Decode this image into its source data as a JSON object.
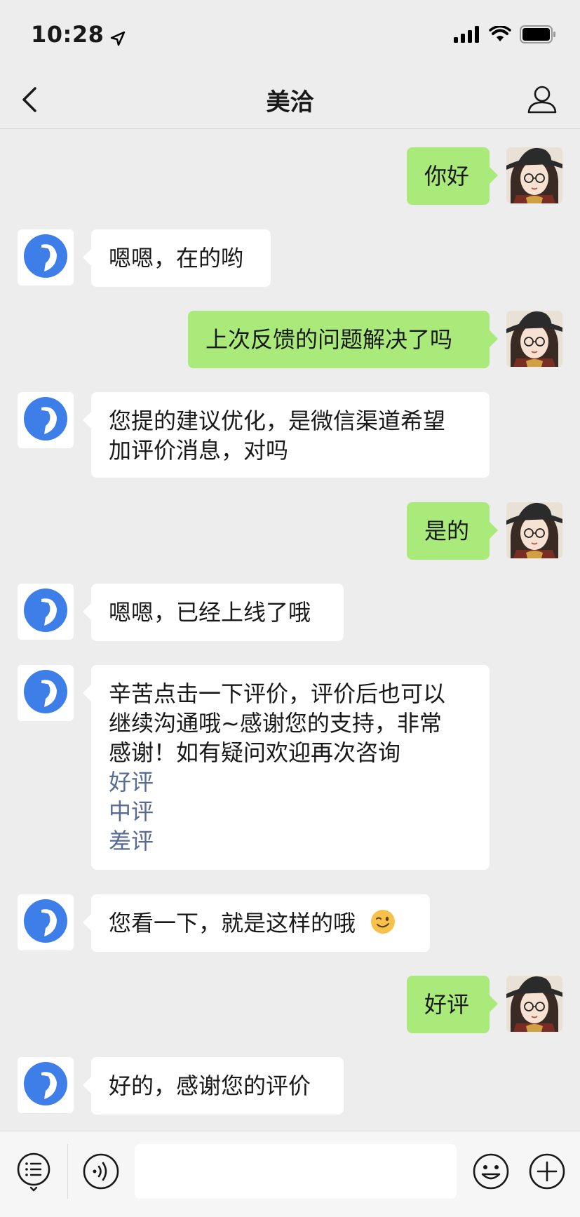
{
  "status_bar": {
    "time": "10:28"
  },
  "nav": {
    "title": "美洽"
  },
  "messages": [
    {
      "side": "right",
      "text": "你好"
    },
    {
      "side": "left",
      "text": "嗯嗯，在的哟"
    },
    {
      "side": "right",
      "text": "上次反馈的问题解决了吗"
    },
    {
      "side": "left",
      "line1": "您提的建议优化，是微信渠道希望",
      "line2": "加评价消息，对吗"
    },
    {
      "side": "right",
      "text": "是的"
    },
    {
      "side": "left",
      "text": "嗯嗯，已经上线了哦"
    },
    {
      "side": "left",
      "line1": "辛苦点击一下评价，评价后也可以",
      "line2": "继续沟通哦~感谢您的支持，非常",
      "line3": "感谢！如有疑问欢迎再次咨询",
      "links": [
        "好评",
        "中评",
        "差评"
      ]
    },
    {
      "side": "left",
      "text": "您看一下，就是这样的哦",
      "emoji": "😉"
    },
    {
      "side": "right",
      "text": "好评"
    },
    {
      "side": "left",
      "text": "好的，感谢您的评价"
    }
  ],
  "input": {
    "placeholder": ""
  },
  "colors": {
    "background": "#ededed",
    "sent_bubble": "#a9ea7a",
    "received_bubble": "#ffffff",
    "link": "#576b95",
    "agent_avatar": "#3d7ee8"
  },
  "icons": [
    "location-arrow-icon",
    "signal-icon",
    "wifi-icon",
    "battery-icon",
    "back-chevron-icon",
    "profile-icon",
    "menu-list-icon",
    "voice-icon",
    "emoji-icon",
    "plus-icon"
  ]
}
